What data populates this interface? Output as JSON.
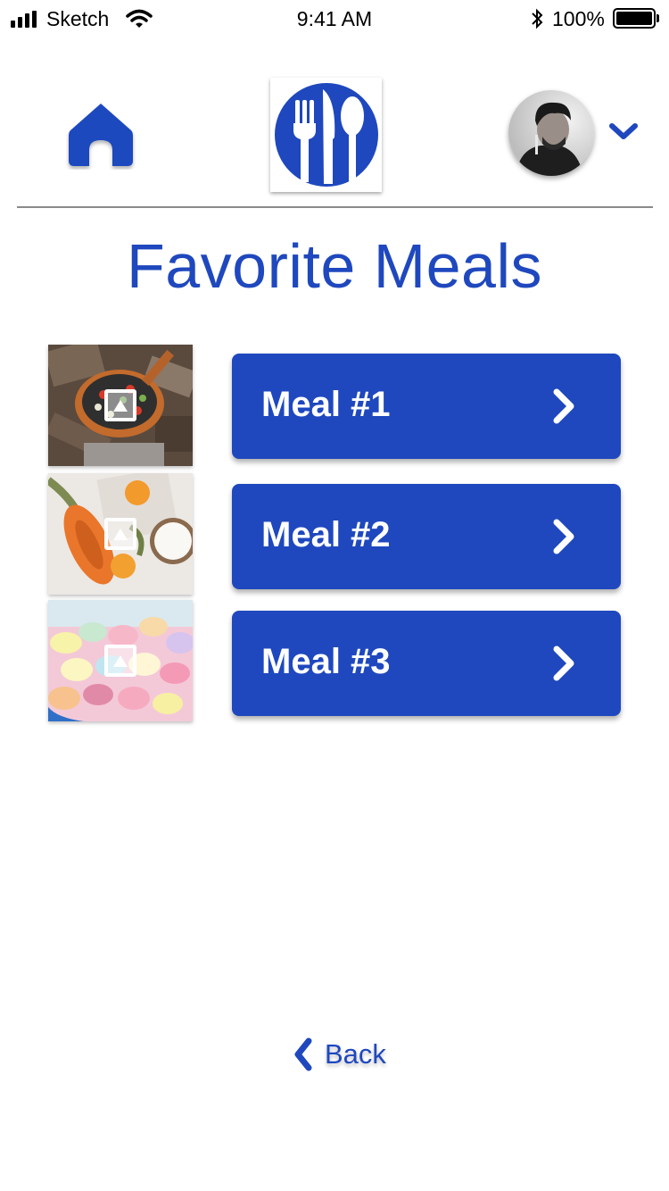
{
  "status_bar": {
    "carrier": "Sketch",
    "time": "9:41 AM",
    "battery_percent": "100%"
  },
  "header": {
    "home_icon": "home-icon",
    "logo_icon": "fork-knife-spoon-logo",
    "avatar_icon": "user-avatar",
    "dropdown_icon": "chevron-down-icon"
  },
  "page": {
    "title": "Favorite Meals"
  },
  "meals": [
    {
      "label": "Meal #1",
      "image": "skillet-vegetables-photo"
    },
    {
      "label": "Meal #2",
      "image": "papaya-coconut-photo"
    },
    {
      "label": "Meal #3",
      "image": "candy-hearts-photo"
    }
  ],
  "footer": {
    "back_label": "Back"
  },
  "colors": {
    "accent": "#1f48be",
    "divider": "#8a8a8a",
    "background": "#ffffff"
  }
}
